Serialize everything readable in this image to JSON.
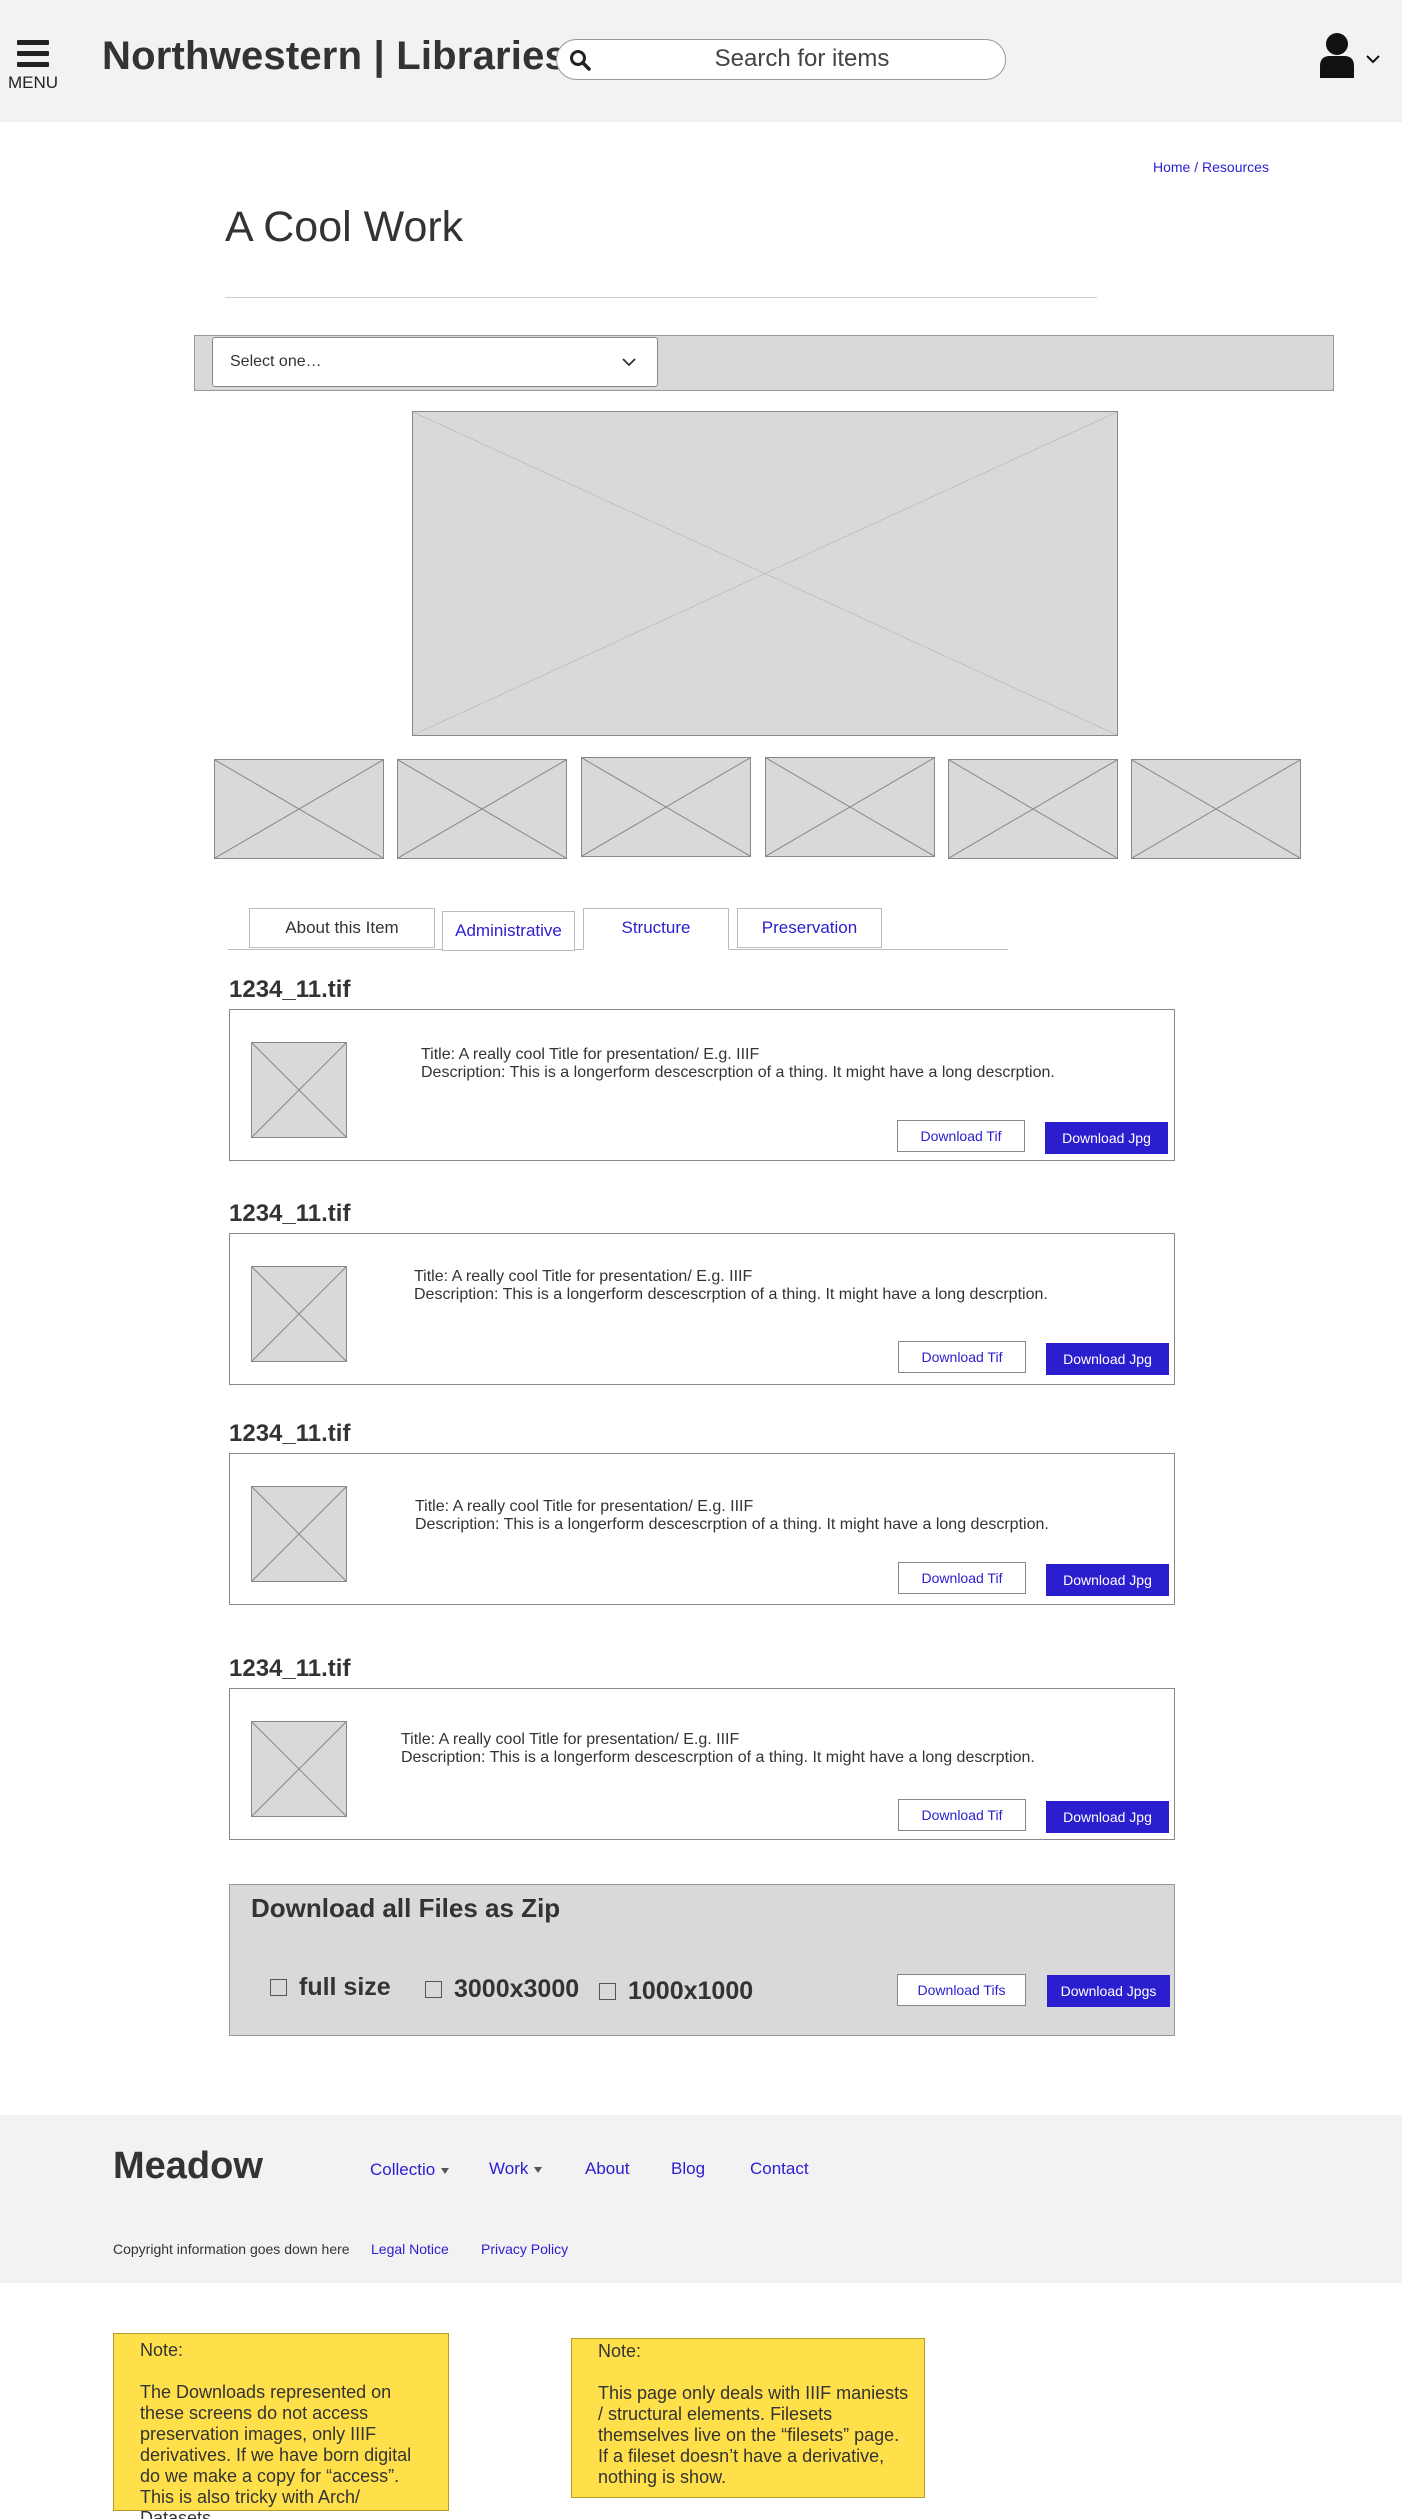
{
  "header": {
    "menu_label": "MENU",
    "site_title": "Northwestern | Libraries",
    "search_placeholder": "Search for items"
  },
  "breadcrumb": {
    "home": "Home",
    "separator": " / ",
    "current": "Resources"
  },
  "page_title": "A Cool Work",
  "select": {
    "value": "Select one…"
  },
  "tabs": [
    {
      "label": "About this Item"
    },
    {
      "label": "Administrative"
    },
    {
      "label": "Structure"
    },
    {
      "label": "Preservation"
    }
  ],
  "files": [
    {
      "name": "1234_11.tif",
      "title": "Title: A really cool Title for presentation/ E.g. IIIF",
      "description": "Description: This is a longerform descescrption of a thing. It might have a long descrption.",
      "download_tif": "Download Tif",
      "download_jpg": "Download Jpg"
    },
    {
      "name": "1234_11.tif",
      "title": "Title: A really cool Title for presentation/ E.g. IIIF",
      "description": "Description: This is a longerform descescrption of a thing. It might have a long descrption.",
      "download_tif": "Download Tif",
      "download_jpg": "Download Jpg"
    },
    {
      "name": "1234_11.tif",
      "title": "Title: A really cool Title for presentation/ E.g. IIIF",
      "description": "Description: This is a longerform descescrption of a thing. It might have a long descrption.",
      "download_tif": "Download Tif",
      "download_jpg": "Download Jpg"
    },
    {
      "name": "1234_11.tif",
      "title": "Title: A really cool Title for presentation/ E.g. IIIF",
      "description": "Description: This is a longerform descescrption of a thing. It might have a long descrption.",
      "download_tif": "Download Tif",
      "download_jpg": "Download Jpg"
    }
  ],
  "zip": {
    "title": "Download all Files as Zip",
    "options": [
      {
        "label": "full size"
      },
      {
        "label": "3000x3000"
      },
      {
        "label": "1000x1000"
      }
    ],
    "download_tifs": "Download Tifs",
    "download_jpgs": "Download Jpgs"
  },
  "footer": {
    "logo": "Meadow",
    "nav": [
      {
        "label": "Collectio"
      },
      {
        "label": "Work"
      },
      {
        "label": "About"
      },
      {
        "label": "Blog"
      },
      {
        "label": "Contact"
      }
    ],
    "copyright": "Copyright information goes down here",
    "legal_notice": "Legal Notice",
    "privacy_policy": "Privacy Policy"
  },
  "notes": [
    {
      "title": "Note:",
      "body": "The Downloads represented on these screens do not access preservation images, only IIIF derivatives. If we have born digital do we make a copy for “access”. This is also tricky with Arch/ Datasets."
    },
    {
      "title": "Note:",
      "body": "This page only deals with IIIF maniests / structural elements. Filesets themselves live on the “filesets” page. If a fileset doesn’t have a derivative, nothing is show."
    }
  ],
  "colors": {
    "link": "#2b1ecf",
    "primary_button": "#2b1ecf",
    "header_bg": "#f2f2f2",
    "placeholder_gray": "#d9d9d9",
    "note_yellow": "#ffe04b"
  },
  "icons": [
    "menu-icon",
    "search-icon",
    "user-icon",
    "chevron-down-icon",
    "image-placeholder-icon",
    "caret-down-icon",
    "checkbox-icon"
  ]
}
